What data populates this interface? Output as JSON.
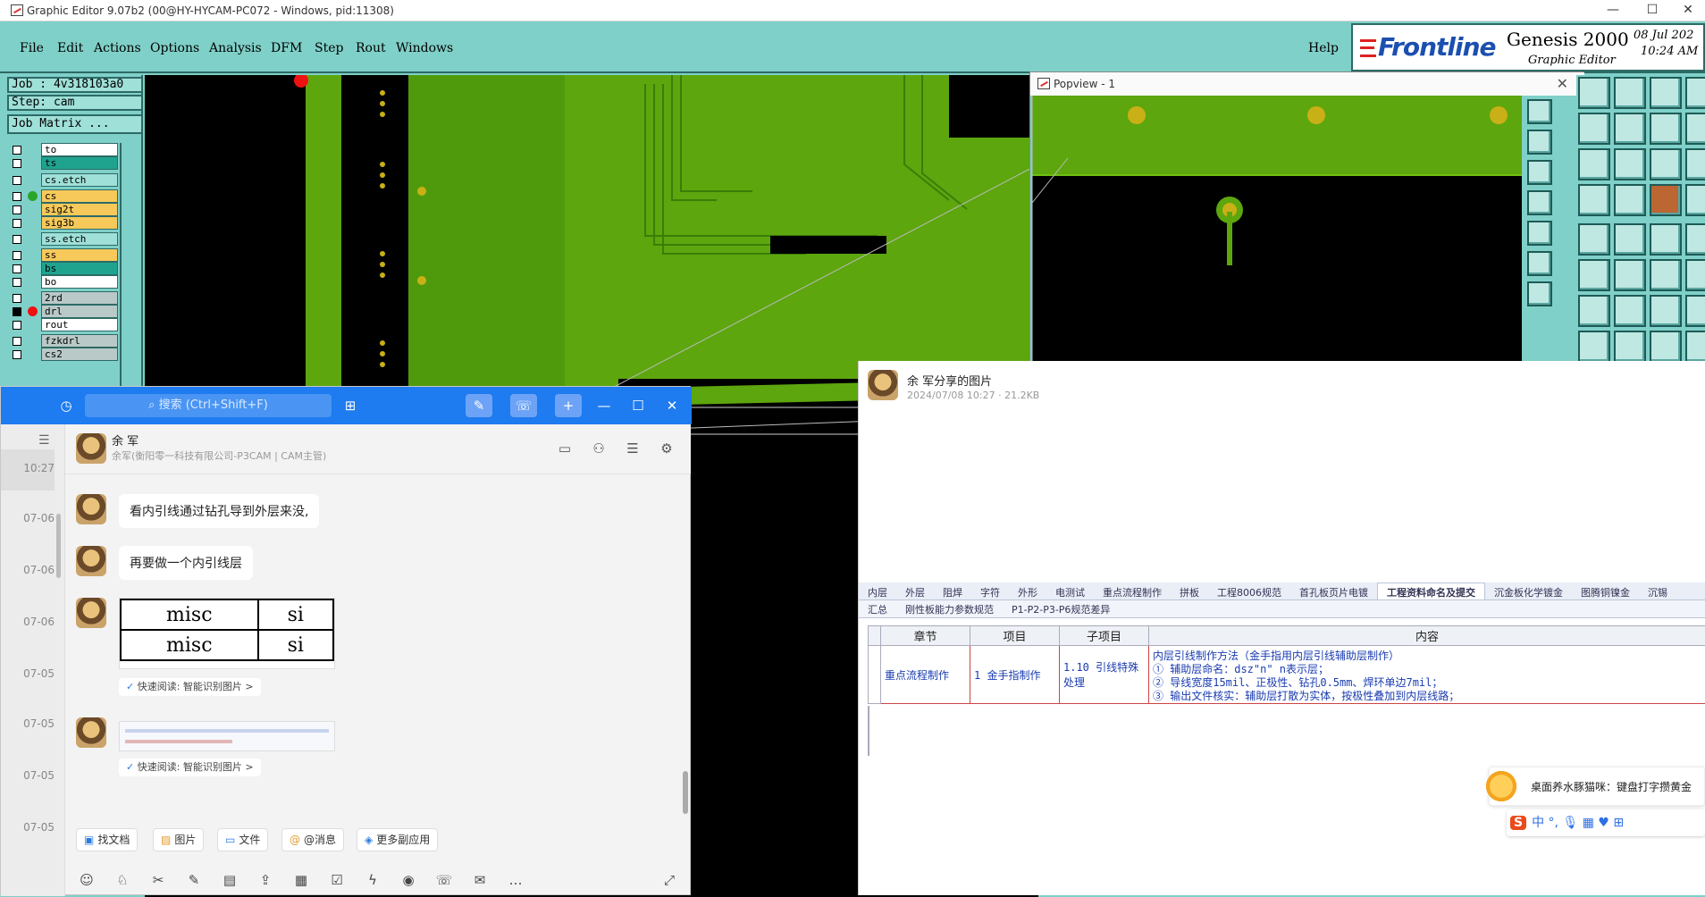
{
  "genesis": {
    "title": "Graphic Editor 9.07b2 (00@HY-HYCAM-PC072 - Windows, pid:11308)",
    "menu": [
      "File",
      "Edit",
      "Actions",
      "Options",
      "Analysis",
      "DFM",
      "Step",
      "Rout",
      "Windows"
    ],
    "help": "Help",
    "brand_logo": "Frontline",
    "brand_name": "Genesis 2000",
    "brand_sub": "Graphic Editor",
    "date": "08 Jul 202",
    "time": "10:24 AM",
    "job": "Job : 4v318103a0",
    "step": "Step: cam",
    "job_matrix": "Job Matrix ...",
    "layers": [
      {
        "name": "to",
        "color": "#ffffff",
        "checked": false
      },
      {
        "name": "ts",
        "color": "#1fa38f",
        "checked": false
      },
      {
        "name": "cs.etch",
        "color": "#9fe0d8",
        "checked": false
      },
      {
        "name": "cs",
        "color": "#f7c95a",
        "checked": false,
        "dot": "#2aa52a"
      },
      {
        "name": "sig2t",
        "color": "#f7c95a",
        "checked": false
      },
      {
        "name": "sig3b",
        "color": "#f7c95a",
        "checked": false
      },
      {
        "name": "ss.etch",
        "color": "#9fe0d8",
        "checked": false
      },
      {
        "name": "ss",
        "color": "#f7c95a",
        "checked": false
      },
      {
        "name": "bs",
        "color": "#1fa38f",
        "checked": false
      },
      {
        "name": "bo",
        "color": "#ffffff",
        "checked": false
      },
      {
        "name": "2rd",
        "color": "#b9c9c7",
        "checked": false
      },
      {
        "name": "drl",
        "color": "#b9c9c7",
        "checked": true,
        "dot": "#ee1111"
      },
      {
        "name": "rout",
        "color": "#ffffff",
        "checked": false
      },
      {
        "name": "fzkdrl",
        "color": "#b9c9c7",
        "checked": false
      },
      {
        "name": "cs2",
        "color": "#b9c9c7",
        "checked": false
      }
    ],
    "popview_title": "Popview - 1",
    "colors": {
      "pcb_green": "#5da60e",
      "trace": "#3f8a0a",
      "pad": "#c9b016",
      "drill": "#ee1111"
    }
  },
  "chat": {
    "search_placeholder": "搜索 (Ctrl+Shift+F)",
    "contact_name": "余 军",
    "contact_sub": "余军(衡阳零一科技有限公司-P3CAM | CAM主管)",
    "side_times": [
      "10:27",
      "07-06",
      "07-06",
      "07-06",
      "07-05",
      "07-05",
      "07-05",
      "07-05"
    ],
    "messages": [
      {
        "type": "text",
        "text": "看内引线通过钻孔导到外层来没,"
      },
      {
        "type": "text",
        "text": "再要做一个内引线层"
      },
      {
        "type": "image",
        "cells": [
          "misc",
          "si",
          "misc",
          "si"
        ]
      },
      {
        "type": "quick",
        "text": "快速阅读: 智能识别图片 >"
      },
      {
        "type": "image2"
      },
      {
        "type": "quick",
        "text": "快速阅读: 智能识别图片 >"
      }
    ],
    "actions": [
      "找文档",
      "图片",
      "文件",
      "@消息",
      "更多副应用"
    ]
  },
  "viewer": {
    "title": "余 军分享的图片",
    "meta": "2024/07/08 10:27 · 21.2KB",
    "tabs1": [
      "内层",
      "外层",
      "阻焊",
      "字符",
      "外形",
      "电测试",
      "重点流程制作",
      "拼板",
      "工程8006规范",
      "首孔板页片电镀",
      "工程资料命名及提交",
      "沉金板化学镀金",
      "图腾铜镍金",
      "沉锡"
    ],
    "tabs2": [
      "汇总",
      "刚性板能力参数规范",
      "P1-P2-P3-P6规范差异"
    ],
    "table": {
      "headers": [
        "章节",
        "项目",
        "子项目",
        "内容"
      ],
      "row": {
        "chapter": "重点流程制作",
        "item": "1 金手指制作",
        "subitem": "1.10 引线特殊处理",
        "content": [
          "内层引线制作方法（金手指用内层引线辅助层制作）",
          "① 辅助层命名：dsz\"n\" n表示层；",
          "② 导线宽度15mil、正极性、钻孔0.5mm、焊环单边7mil；",
          "③ 输出文件核实：辅助层打散为实体，按极性叠加到内层线路；"
        ]
      }
    }
  },
  "ime": {
    "tip": "桌面养水豚猫咪：键盘打字攒黄金",
    "mode": "中"
  }
}
